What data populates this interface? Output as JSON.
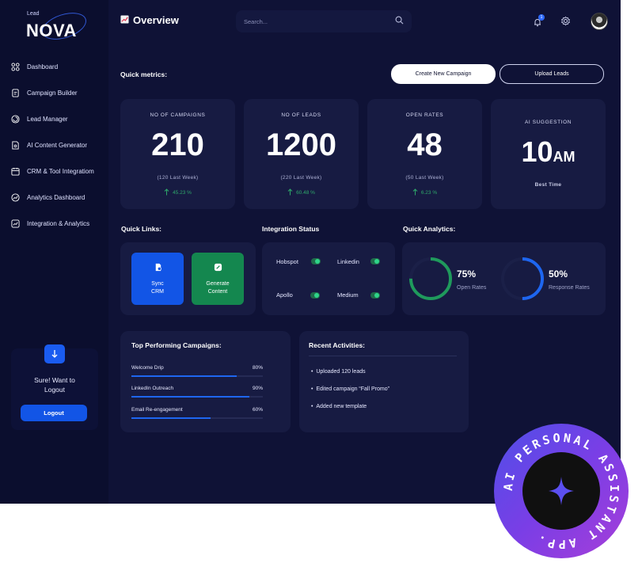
{
  "brand": {
    "lead": "Lead",
    "name": "NOVA"
  },
  "header": {
    "title": "Overview",
    "title_icon": "chart-emoji-icon",
    "search_placeholder": "Search...",
    "notification_count": "1"
  },
  "sidebar": {
    "items": [
      {
        "label": "Dashboard",
        "icon": "grid-icon"
      },
      {
        "label": "Campaign Builder",
        "icon": "document-icon"
      },
      {
        "label": "Lead Manager",
        "icon": "spiral-icon"
      },
      {
        "label": "AI Content Generator",
        "icon": "ai-doc-icon"
      },
      {
        "label": "CRM & Tool Integratiom",
        "icon": "calendar-icon"
      },
      {
        "label": "Analytics Dashboard",
        "icon": "trend-icon"
      },
      {
        "label": "Integration & Analytics",
        "icon": "trend-box-icon"
      }
    ],
    "logout_card": {
      "text": "Sure! Want to\nLogout",
      "button": "Logout",
      "icon": "arrow-down-icon"
    }
  },
  "quick_metrics": {
    "label": "Quick metrics:",
    "create_button": "Create New Campaign",
    "upload_button": "Upload Leads",
    "cards": [
      {
        "label": "NO OF CAMPAIGNS",
        "value": "210",
        "sub": "(120 Last Week)",
        "change": "45.23 %"
      },
      {
        "label": "NO OF LEADS",
        "value": "1200",
        "sub": "(220 Last Week)",
        "change": "60.48 %"
      },
      {
        "label": "OPEN RATES",
        "value": "48",
        "sub": "(50 Last Week)",
        "change": "6.23 %"
      }
    ],
    "ai": {
      "label": "AI SUGGESTION",
      "value": "10",
      "unit": "AM",
      "sub": "Best Time"
    }
  },
  "quick_links": {
    "label": "Quick Links:",
    "tiles": [
      {
        "label": "Sync\nCRM",
        "color": "#1255e6",
        "icon": "sync-crm-icon"
      },
      {
        "label": "Generate\nContent",
        "color": "#14874f",
        "icon": "edit-icon"
      }
    ]
  },
  "integration_status": {
    "label": "Integration Status",
    "items": [
      {
        "name": "Hobspot",
        "enabled": true
      },
      {
        "name": "Linkedin",
        "enabled": true
      },
      {
        "name": "Apollo",
        "enabled": true
      },
      {
        "name": "Medium",
        "enabled": true
      }
    ]
  },
  "quick_analytics": {
    "label": "Quick Analytics:",
    "items": [
      {
        "pct": "75%",
        "label": "Open Rates",
        "fraction": 0.75,
        "color": "#1f9a5c"
      },
      {
        "pct": "50%",
        "label": "Response Rates",
        "fraction": 0.5,
        "color": "#1e66f0"
      }
    ]
  },
  "top_campaigns": {
    "label": "Top Performing Campaigns:",
    "rows": [
      {
        "name": "Welcome Drip",
        "pct": "80%",
        "fraction": 0.8
      },
      {
        "name": "LinkedIn Outreach",
        "pct": "90%",
        "fraction": 0.9
      },
      {
        "name": "Email Re-engagement",
        "pct": "60%",
        "fraction": 0.6
      }
    ]
  },
  "recent_activities": {
    "label": "Recent Activities:",
    "items": [
      "Uploaded 120 leads",
      "Edited campaign “Fall Promo”",
      "Added new template"
    ]
  },
  "badge": {
    "text": "AI PERSONAL ASSISTANT APP.",
    "icon": "sparkle-star-icon"
  }
}
